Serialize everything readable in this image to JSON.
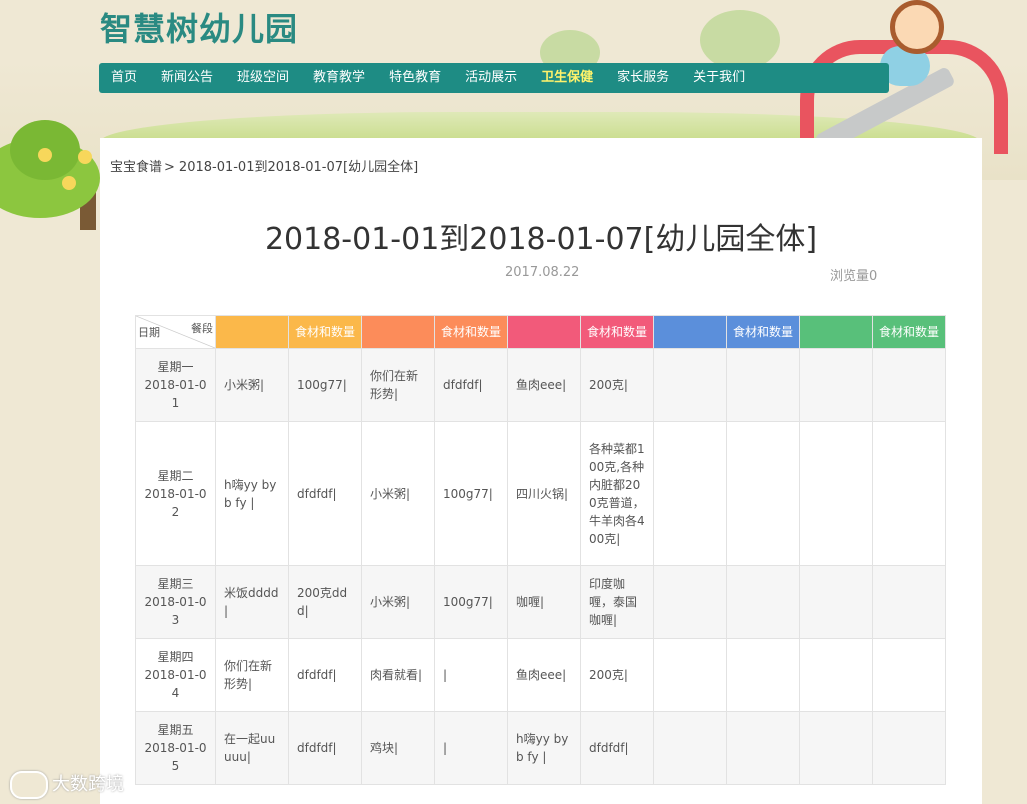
{
  "site": {
    "title": "智慧树幼儿园"
  },
  "nav": [
    {
      "label": "首页"
    },
    {
      "label": "新闻公告"
    },
    {
      "label": "班级空间"
    },
    {
      "label": "教育教学"
    },
    {
      "label": "特色教育"
    },
    {
      "label": "活动展示"
    },
    {
      "label": "卫生保健",
      "active": true
    },
    {
      "label": "家长服务"
    },
    {
      "label": "关于我们"
    }
  ],
  "breadcrumb": {
    "parent": "宝宝食谱",
    "separator": ">",
    "current": "2018-01-01到2018-01-07[幼儿园全体]"
  },
  "article": {
    "title": "2018-01-01到2018-01-07[幼儿园全体]",
    "date": "2017.08.22",
    "views": "浏览量0"
  },
  "table": {
    "corner": {
      "top": "餐段",
      "bottom": "日期"
    },
    "header_colors": [
      "#fbb84a",
      "#fbb84a",
      "#fc8c5a",
      "#fc8c5a",
      "#f25a7a",
      "#f25a7a",
      "#5b8fdb",
      "#5b8fdb",
      "#58c07a",
      "#58c07a"
    ],
    "headers": [
      "",
      "食材和数量",
      "",
      "食材和数量",
      "",
      "食材和数量",
      "",
      "食材和数量",
      "",
      "食材和数量"
    ],
    "rows": [
      {
        "date": "星期一\n2018-01-01",
        "cells": [
          "小米粥|",
          "100g77|",
          "你们在新形势|",
          "dfdfdf|",
          "鱼肉eee|",
          "200克|",
          "",
          "",
          "",
          ""
        ]
      },
      {
        "date": "星期二\n2018-01-02",
        "cells": [
          "h嗨yy by b fy |",
          "dfdfdf|",
          "小米粥|",
          "100g77|",
          "四川火锅|",
          "各种菜都100克,各种内脏都200克普道，牛羊肉各400克|",
          "",
          "",
          "",
          ""
        ]
      },
      {
        "date": "星期三\n2018-01-03",
        "cells": [
          "米饭dddd|",
          "200克ddd|",
          "小米粥|",
          "100g77|",
          "咖喱|",
          "印度咖喱，泰国咖喱|",
          "",
          "",
          "",
          ""
        ]
      },
      {
        "date": "星期四\n2018-01-04",
        "cells": [
          "你们在新形势|",
          "dfdfdf|",
          "肉看就看|",
          "|",
          "鱼肉eee|",
          "200克|",
          "",
          "",
          "",
          ""
        ]
      },
      {
        "date": "星期五\n2018-01-05",
        "cells": [
          "在一起uu uuu|",
          "dfdfdf|",
          "鸡块|",
          "|",
          "h嗨yy by b fy |",
          "dfdfdf|",
          "",
          "",
          "",
          ""
        ]
      }
    ]
  },
  "watermark": {
    "text": "大数跨境"
  }
}
